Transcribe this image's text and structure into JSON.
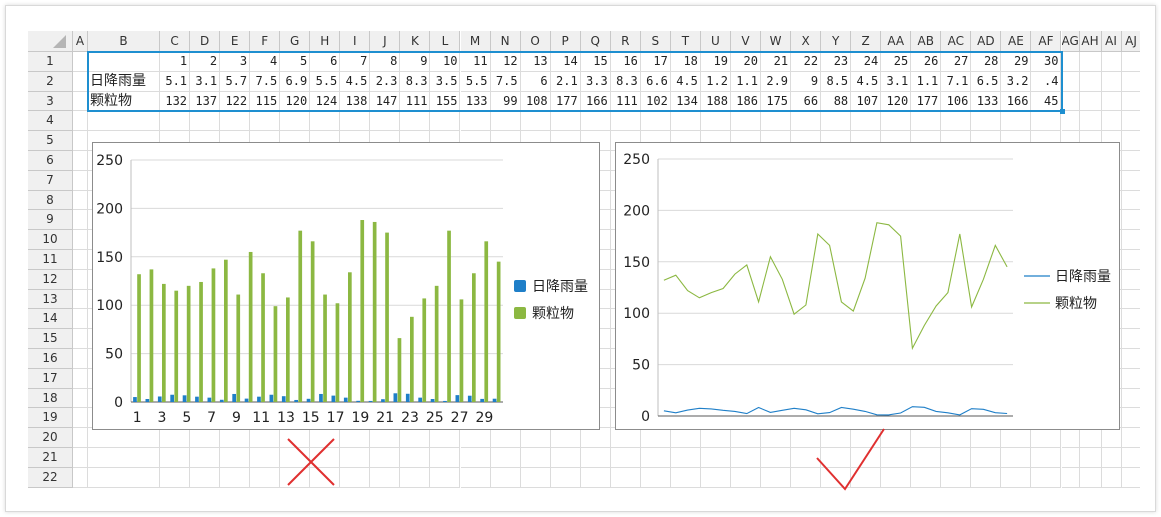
{
  "spreadsheet": {
    "columns": [
      "A",
      "B",
      "C",
      "D",
      "E",
      "F",
      "G",
      "H",
      "I",
      "J",
      "K",
      "L",
      "M",
      "N",
      "O",
      "P",
      "Q",
      "R",
      "S",
      "T",
      "U",
      "V",
      "W",
      "X",
      "Y",
      "Z",
      "AA",
      "AB",
      "AC",
      "AD",
      "AE",
      "AF",
      "AG",
      "AH",
      "AI",
      "AJ",
      "A"
    ],
    "rows": [
      "1",
      "2",
      "3",
      "4",
      "5",
      "6",
      "7",
      "8",
      "9",
      "10",
      "11",
      "12",
      "13",
      "14",
      "15",
      "16",
      "17",
      "18",
      "19",
      "20",
      "21",
      "22"
    ],
    "row1_values": [
      "1",
      "2",
      "3",
      "4",
      "5",
      "6",
      "7",
      "8",
      "9",
      "10",
      "11",
      "12",
      "13",
      "14",
      "15",
      "16",
      "17",
      "18",
      "19",
      "20",
      "21",
      "22",
      "23",
      "24",
      "25",
      "26",
      "27",
      "28",
      "29",
      "30"
    ],
    "row2_label": "日降雨量",
    "row2_values": [
      "5.1",
      "3.1",
      "5.7",
      "7.5",
      "6.9",
      "5.5",
      "4.5",
      "2.3",
      "8.3",
      "3.5",
      "5.5",
      "7.5",
      "6",
      "2.1",
      "3.3",
      "8.3",
      "6.6",
      "4.5",
      "1.2",
      "1.1",
      "2.9",
      "9",
      "8.5",
      "4.5",
      "3.1",
      "1.1",
      "7.1",
      "6.5",
      "3.2",
      ".4"
    ],
    "row3_label": "颗粒物",
    "row3_values": [
      "132",
      "137",
      "122",
      "115",
      "120",
      "124",
      "138",
      "147",
      "111",
      "155",
      "133",
      "99",
      "108",
      "177",
      "166",
      "111",
      "102",
      "134",
      "188",
      "186",
      "175",
      "66",
      "88",
      "107",
      "120",
      "177",
      "106",
      "133",
      "166",
      "45"
    ]
  },
  "marks": {
    "wrong": "cross-mark",
    "right": "check-mark",
    "wrong_color": "#e03030",
    "right_color": "#e03030"
  },
  "chart_data": [
    {
      "type": "bar",
      "categories": [
        "1",
        "2",
        "3",
        "4",
        "5",
        "6",
        "7",
        "8",
        "9",
        "10",
        "11",
        "12",
        "13",
        "14",
        "15",
        "16",
        "17",
        "18",
        "19",
        "20",
        "21",
        "22",
        "23",
        "24",
        "25",
        "26",
        "27",
        "28",
        "29",
        "30"
      ],
      "x_tick_labels": [
        "1",
        "3",
        "5",
        "7",
        "9",
        "11",
        "13",
        "15",
        "17",
        "19",
        "21",
        "23",
        "25",
        "27",
        "29"
      ],
      "y_ticks": [
        "0",
        "50",
        "100",
        "150",
        "200",
        "250"
      ],
      "ylim": [
        0,
        250
      ],
      "grid": true,
      "legend_position": "right",
      "series": [
        {
          "name": "日降雨量",
          "color": "#1f7fc8",
          "values": [
            5.1,
            3.1,
            5.7,
            7.5,
            6.9,
            5.5,
            4.5,
            2.3,
            8.3,
            3.5,
            5.5,
            7.5,
            6,
            2.1,
            3.3,
            8.3,
            6.6,
            4.5,
            1.2,
            1.1,
            2.9,
            9,
            8.5,
            4.5,
            3.1,
            1.1,
            7.1,
            6.5,
            3.2,
            3.4
          ]
        },
        {
          "name": "颗粒物",
          "color": "#8cb842",
          "values": [
            132,
            137,
            122,
            115,
            120,
            124,
            138,
            147,
            111,
            155,
            133,
            99,
            108,
            177,
            166,
            111,
            102,
            134,
            188,
            186,
            175,
            66,
            88,
            107,
            120,
            177,
            106,
            133,
            166,
            145
          ]
        }
      ]
    },
    {
      "type": "line",
      "categories": [
        "1",
        "2",
        "3",
        "4",
        "5",
        "6",
        "7",
        "8",
        "9",
        "10",
        "11",
        "12",
        "13",
        "14",
        "15",
        "16",
        "17",
        "18",
        "19",
        "20",
        "21",
        "22",
        "23",
        "24",
        "25",
        "26",
        "27",
        "28",
        "29",
        "30"
      ],
      "y_ticks": [
        "0",
        "50",
        "100",
        "150",
        "200",
        "250"
      ],
      "ylim": [
        0,
        250
      ],
      "grid": true,
      "legend_position": "right",
      "series": [
        {
          "name": "日降雨量",
          "color": "#1f7fc8",
          "values": [
            5.1,
            3.1,
            5.7,
            7.5,
            6.9,
            5.5,
            4.5,
            2.3,
            8.3,
            3.5,
            5.5,
            7.5,
            6,
            2.1,
            3.3,
            8.3,
            6.6,
            4.5,
            1.2,
            1.1,
            2.9,
            9,
            8.5,
            4.5,
            3.1,
            1.1,
            7.1,
            6.5,
            3.2,
            2.4
          ]
        },
        {
          "name": "颗粒物",
          "color": "#8cb842",
          "values": [
            132,
            137,
            122,
            115,
            120,
            124,
            138,
            147,
            111,
            155,
            133,
            99,
            108,
            177,
            166,
            111,
            102,
            134,
            188,
            186,
            175,
            66,
            88,
            107,
            120,
            177,
            106,
            133,
            166,
            145
          ]
        }
      ]
    }
  ]
}
